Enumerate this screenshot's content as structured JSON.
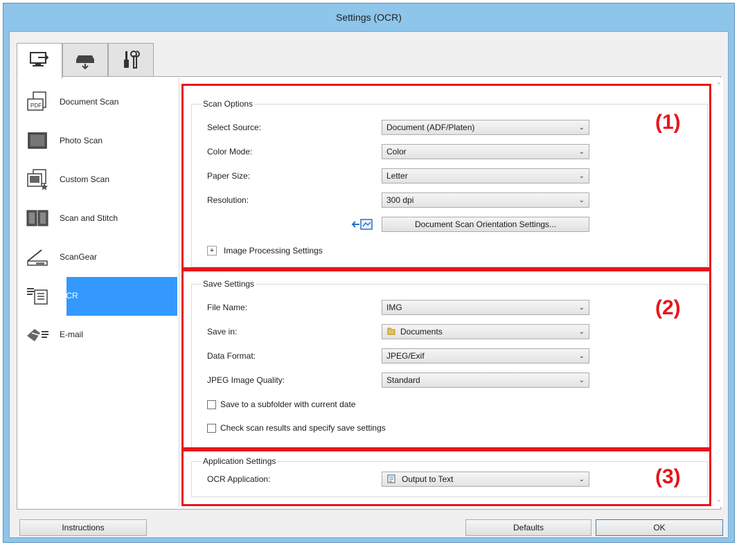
{
  "window": {
    "title": "Settings (OCR)"
  },
  "tabs": [
    {
      "name": "scan-from-computer-tab",
      "icon": "computer-scan-icon"
    },
    {
      "name": "scan-from-panel-tab",
      "icon": "scanner-icon"
    },
    {
      "name": "general-settings-tab",
      "icon": "tools-icon"
    }
  ],
  "sidebar": {
    "items": [
      {
        "label": "Document Scan",
        "icon": "document-scan-icon"
      },
      {
        "label": "Photo Scan",
        "icon": "photo-scan-icon"
      },
      {
        "label": "Custom Scan",
        "icon": "custom-scan-icon"
      },
      {
        "label": "Scan and Stitch",
        "icon": "scan-and-stitch-icon"
      },
      {
        "label": "ScanGear",
        "icon": "scangear-icon"
      },
      {
        "label": "OCR",
        "icon": "ocr-icon",
        "selected": true
      },
      {
        "label": "E-mail",
        "icon": "email-icon"
      }
    ]
  },
  "scan_options": {
    "title": "Scan Options",
    "select_source_label": "Select Source:",
    "select_source_value": "Document (ADF/Platen)",
    "color_mode_label": "Color Mode:",
    "color_mode_value": "Color",
    "paper_size_label": "Paper Size:",
    "paper_size_value": "Letter",
    "resolution_label": "Resolution:",
    "resolution_value": "300 dpi",
    "orientation_button": "Document Scan Orientation Settings...",
    "image_processing_label": "Image Processing Settings",
    "expand_symbol": "+"
  },
  "save_settings": {
    "title": "Save Settings",
    "file_name_label": "File Name:",
    "file_name_value": "IMG",
    "save_in_label": "Save in:",
    "save_in_value": "Documents",
    "data_format_label": "Data Format:",
    "data_format_value": "JPEG/Exif",
    "jpeg_quality_label": "JPEG Image Quality:",
    "jpeg_quality_value": "Standard",
    "subfolder_checkbox": "Save to a subfolder with current date",
    "check_results_checkbox": "Check scan results and specify save settings"
  },
  "application_settings": {
    "title": "Application Settings",
    "ocr_app_label": "OCR Application:",
    "ocr_app_value": "Output to Text"
  },
  "annotations": {
    "one": "(1)",
    "two": "(2)",
    "three": "(3)"
  },
  "footer": {
    "instructions": "Instructions",
    "defaults": "Defaults",
    "ok": "OK"
  },
  "colors": {
    "annotation_red": "#e8141b",
    "selection_blue": "#3399ff",
    "title_bar": "#8ec5ea"
  }
}
